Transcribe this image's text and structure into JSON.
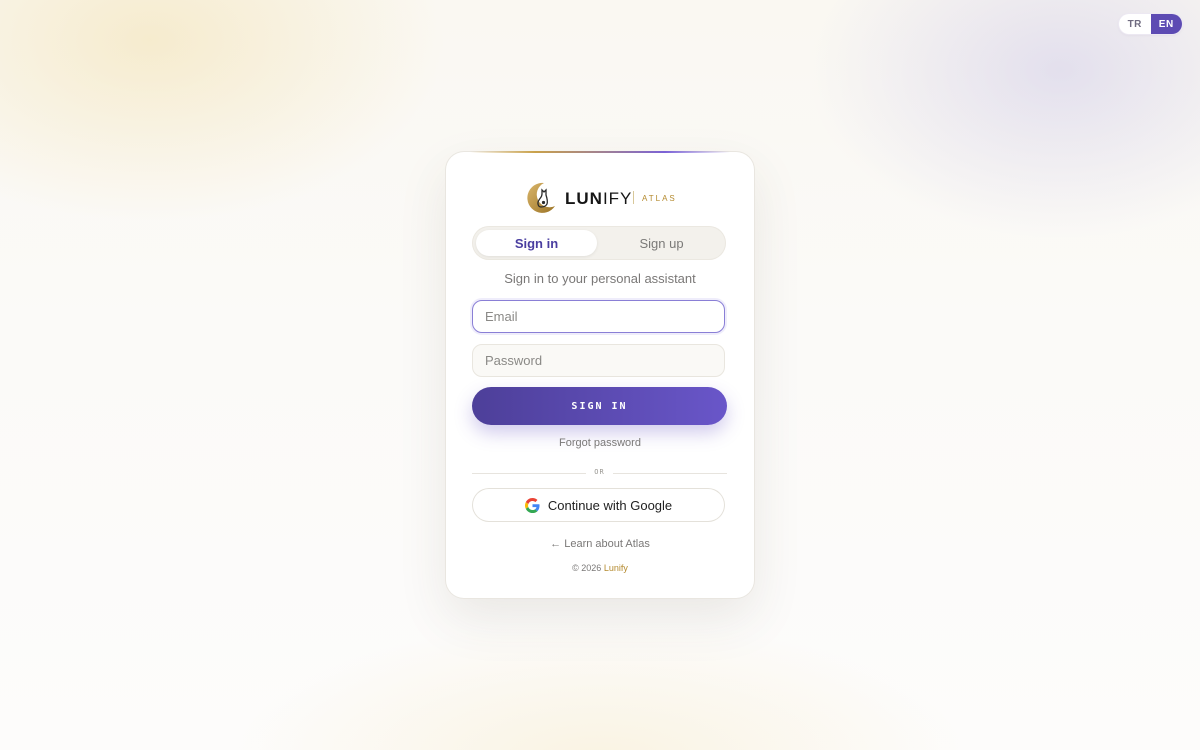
{
  "language": {
    "options": [
      "TR",
      "EN"
    ],
    "active": "EN"
  },
  "brand": {
    "name_bold": "LUN",
    "name_light": "IFY",
    "product": "ATLAS",
    "logo_icon": "crescent-cat-logo"
  },
  "tabs": [
    {
      "label": "Sign in",
      "active": true
    },
    {
      "label": "Sign up",
      "active": false
    }
  ],
  "subtitle": "Sign in to your personal assistant",
  "form": {
    "email_placeholder": "Email",
    "email_value": "",
    "password_placeholder": "Password",
    "password_value": "",
    "submit_label": "SIGN IN"
  },
  "forgot_password": "Forgot password",
  "divider_text": "OR",
  "google_button": {
    "label": "Continue with Google",
    "icon": "google-icon"
  },
  "learn_link": "← Learn about Atlas",
  "footer": {
    "copyright": "© 2026",
    "brand_link": "Lunify"
  },
  "colors": {
    "accent": "#5d4bb3",
    "gold": "#b48a2e",
    "button_start": "#4d3f99",
    "button_end": "#6956c9"
  }
}
